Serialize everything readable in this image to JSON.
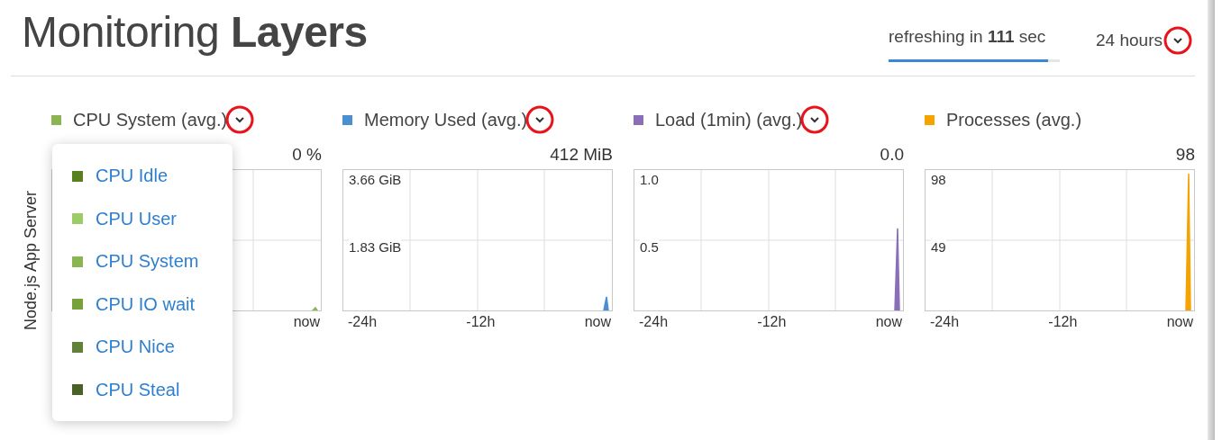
{
  "title": "Monitoring **Layers**",
  "refresh": {
    "text": "refreshing in **111** sec",
    "level": 0.93
  },
  "time_range": {
    "label": "24 hours",
    "highlighted": true
  },
  "row_label": "Node.js App Server",
  "metrics": [
    {
      "name": "CPU System (avg.)",
      "color": "#8bb552",
      "menu": {
        "highlighted": true
      },
      "value": "0 %",
      "x_labels": [
        "now"
      ]
    },
    {
      "name": "Memory Used (avg.)",
      "color": "#4a8fd1",
      "menu": {
        "highlighted": true
      },
      "value": "412 MiB",
      "y_labels": [
        "3.66 GiB",
        "1.83 GiB"
      ],
      "x_labels": [
        "-24h",
        "-12h",
        "now"
      ]
    },
    {
      "name": "Load (1min) (avg.)",
      "color": "#8a6fb8",
      "menu": {
        "highlighted": true
      },
      "value": "0.0",
      "y_labels": [
        "1.0",
        "0.5"
      ],
      "x_labels": [
        "-24h",
        "-12h",
        "now"
      ]
    },
    {
      "name": "Processes (avg.)",
      "color": "#f5a300",
      "value": "98",
      "y_labels": [
        "98",
        "49"
      ],
      "x_labels": [
        "-24h",
        "-12h",
        "now"
      ]
    }
  ],
  "dropdown": {
    "items": [
      {
        "label": "CPU Idle",
        "color": "#5a7f1f"
      },
      {
        "label": "CPU User",
        "color": "#9ccc65"
      },
      {
        "label": "CPU System",
        "color": "#8bb552"
      },
      {
        "label": "CPU IO wait",
        "color": "#78a13c"
      },
      {
        "label": "CPU Nice",
        "color": "#63803a"
      },
      {
        "label": "CPU Steal",
        "color": "#4a6126"
      }
    ]
  }
}
